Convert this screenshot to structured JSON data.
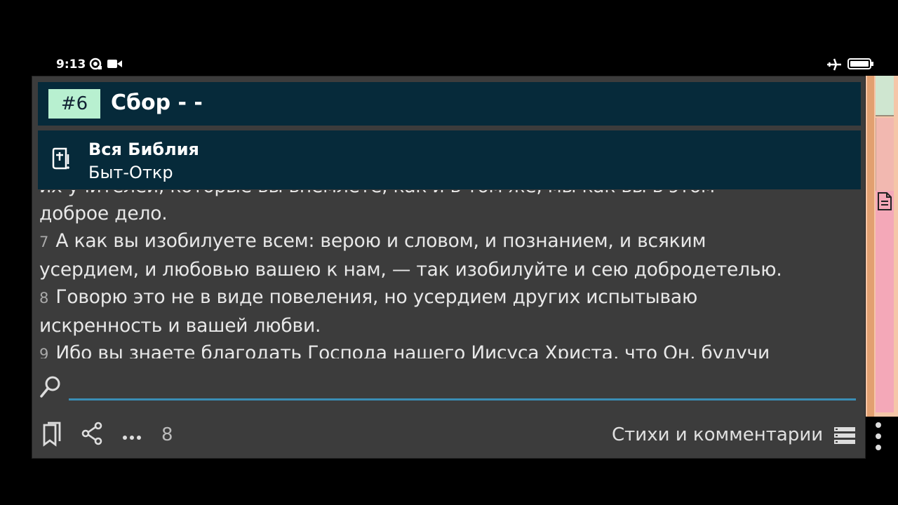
{
  "status_bar": {
    "time": "9:13"
  },
  "dialog": {
    "tab_badge": "#6",
    "title": "Сбор - -",
    "module": {
      "name": "Вся Библия",
      "range": "Быт-Откр"
    },
    "verses": {
      "partial_top": "их учителей, которые вы внемлете, как и в том же, мы как вы в этом",
      "v6_tail": "доброе дело.",
      "v7_num": "7",
      "v7_line1": "А как вы изобилуете всем: верою и словом, и познанием, и всяким",
      "v7_line2": "усердием, и любовью вашею к нам, — так изобилуйте и сею добродетелью.",
      "v8_num": "8",
      "v8_line1": "Говорю это не в виде повеления, но усердием других испытываю",
      "v8_line2": "искренность и вашей любви.",
      "v9_num": "9",
      "v9_line1": "Ибо вы знаете благодать Господа нашего Иисуса Христа, что Он, будучи"
    },
    "search": {
      "placeholder": "",
      "value": ""
    },
    "bottom": {
      "count": "8",
      "label": "Стихи и комментарии"
    }
  },
  "colors": {
    "accent": "#3a8eb5",
    "header_bg": "#062a3a",
    "badge_bg": "#b8f0d0",
    "dialog_bg": "#3c3c3c"
  },
  "icons": [
    "camera-icon",
    "video-icon",
    "airplane-icon",
    "battery-icon",
    "bible-book-icon",
    "search-icon",
    "bookmark-icon",
    "share-icon",
    "more-horizontal-icon",
    "list-icon",
    "more-vertical-icon",
    "document-icon"
  ]
}
